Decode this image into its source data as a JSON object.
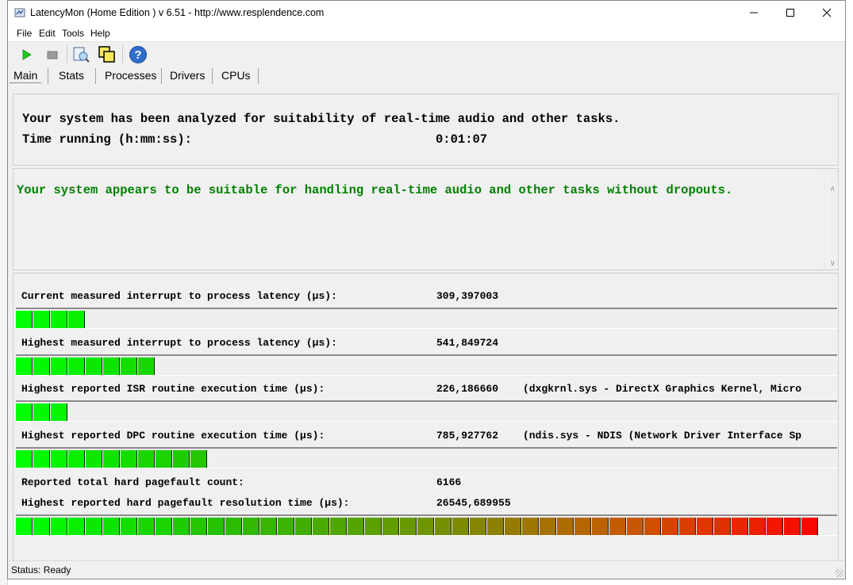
{
  "window": {
    "title": "LatencyMon  (Home Edition )  v 6.51 - http://www.resplendence.com",
    "minimize_icon": "minimize-icon",
    "maximize_icon": "maximize-icon",
    "close_icon": "close-icon"
  },
  "menu": {
    "items": [
      "File",
      "Edit",
      "Tools",
      "Help"
    ]
  },
  "toolbar": {
    "icons": [
      "play-icon",
      "stop-icon",
      "report-icon",
      "cpu-icon",
      "help-icon"
    ]
  },
  "tabs": {
    "items": [
      "Main",
      "Stats",
      "Processes",
      "Drivers",
      "CPUs"
    ],
    "active": "Main"
  },
  "summary": {
    "analyzed_text": "Your system has been analyzed for suitability of real-time audio and other tasks.",
    "time_label": "Time running (h:mm:ss):",
    "time_value": "0:01:07"
  },
  "verdict": {
    "text": "Your system appears to be suitable for handling real-time audio and other tasks without dropouts.",
    "color": "#008000"
  },
  "metrics": [
    {
      "label": "Current measured interrupt to process latency (µs):",
      "value": "309,397003",
      "detail": ""
    },
    {
      "label": "Highest measured interrupt to process latency (µs):",
      "value": "541,849724",
      "detail": ""
    },
    {
      "label": "Highest reported ISR routine execution time (µs):",
      "value": "226,186660",
      "detail": "(dxgkrnl.sys - DirectX Graphics Kernel, Micro"
    },
    {
      "label": "Highest reported DPC routine execution time (µs):",
      "value": "785,927762",
      "detail": "(ndis.sys - NDIS (Network Driver Interface Sp"
    },
    {
      "label": "Reported total hard pagefault count:",
      "value": "6166",
      "detail": ""
    },
    {
      "label": "Highest reported hard pagefault resolution time (µs):",
      "value": "26545,689955",
      "detail": ""
    }
  ],
  "bars": [
    {
      "segments": 4
    },
    {
      "segments": 8
    },
    {
      "segments": 3
    },
    {
      "segments": 11
    },
    {
      "segments": 46
    }
  ],
  "bar_total_segments": 47,
  "statusbar": {
    "text": "Status: Ready"
  }
}
